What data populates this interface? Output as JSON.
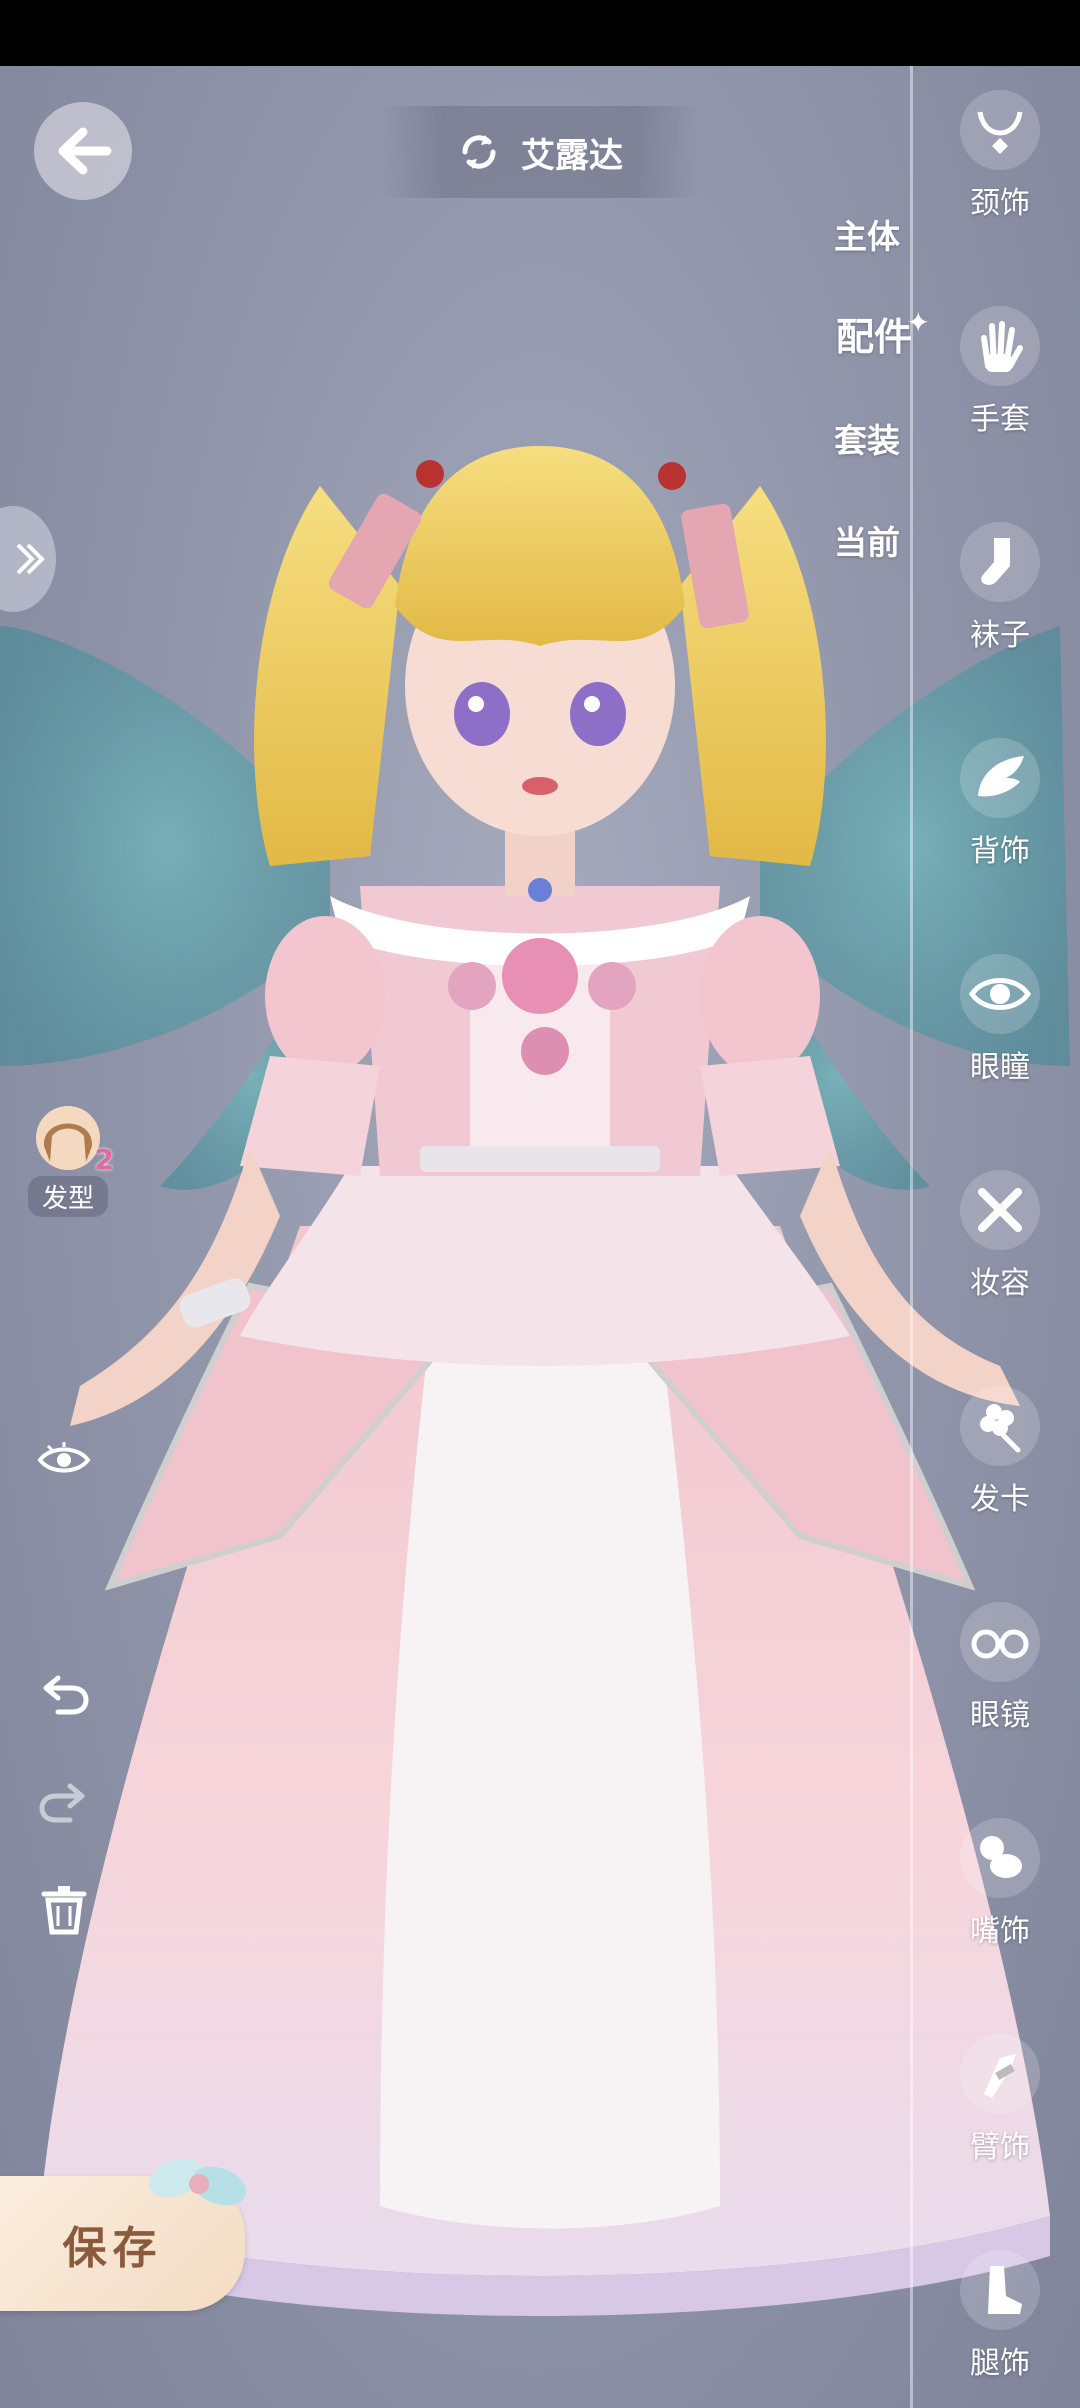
{
  "character": {
    "name": "艾露达"
  },
  "category_tabs": [
    {
      "label": "主体",
      "active": false
    },
    {
      "label": "配件",
      "active": true
    },
    {
      "label": "套装",
      "active": false
    },
    {
      "label": "当前",
      "active": false
    }
  ],
  "sidebar": {
    "items": [
      {
        "label": "颈饰",
        "icon": "necklace-icon"
      },
      {
        "label": "手套",
        "icon": "glove-icon"
      },
      {
        "label": "袜子",
        "icon": "sock-icon"
      },
      {
        "label": "背饰",
        "icon": "wing-icon"
      },
      {
        "label": "眼瞳",
        "icon": "eye-icon"
      },
      {
        "label": "妆容",
        "icon": "makeup-brush-icon"
      },
      {
        "label": "发卡",
        "icon": "hairpin-flower-icon"
      },
      {
        "label": "眼镜",
        "icon": "glasses-icon"
      },
      {
        "label": "嘴饰",
        "icon": "pacifier-icon"
      },
      {
        "label": "臂饰",
        "icon": "arm-accessory-icon"
      },
      {
        "label": "腿饰",
        "icon": "boot-icon"
      }
    ]
  },
  "left_panel": {
    "hair": {
      "label": "发型",
      "badge": "2"
    }
  },
  "save_button": {
    "label": "保存"
  }
}
